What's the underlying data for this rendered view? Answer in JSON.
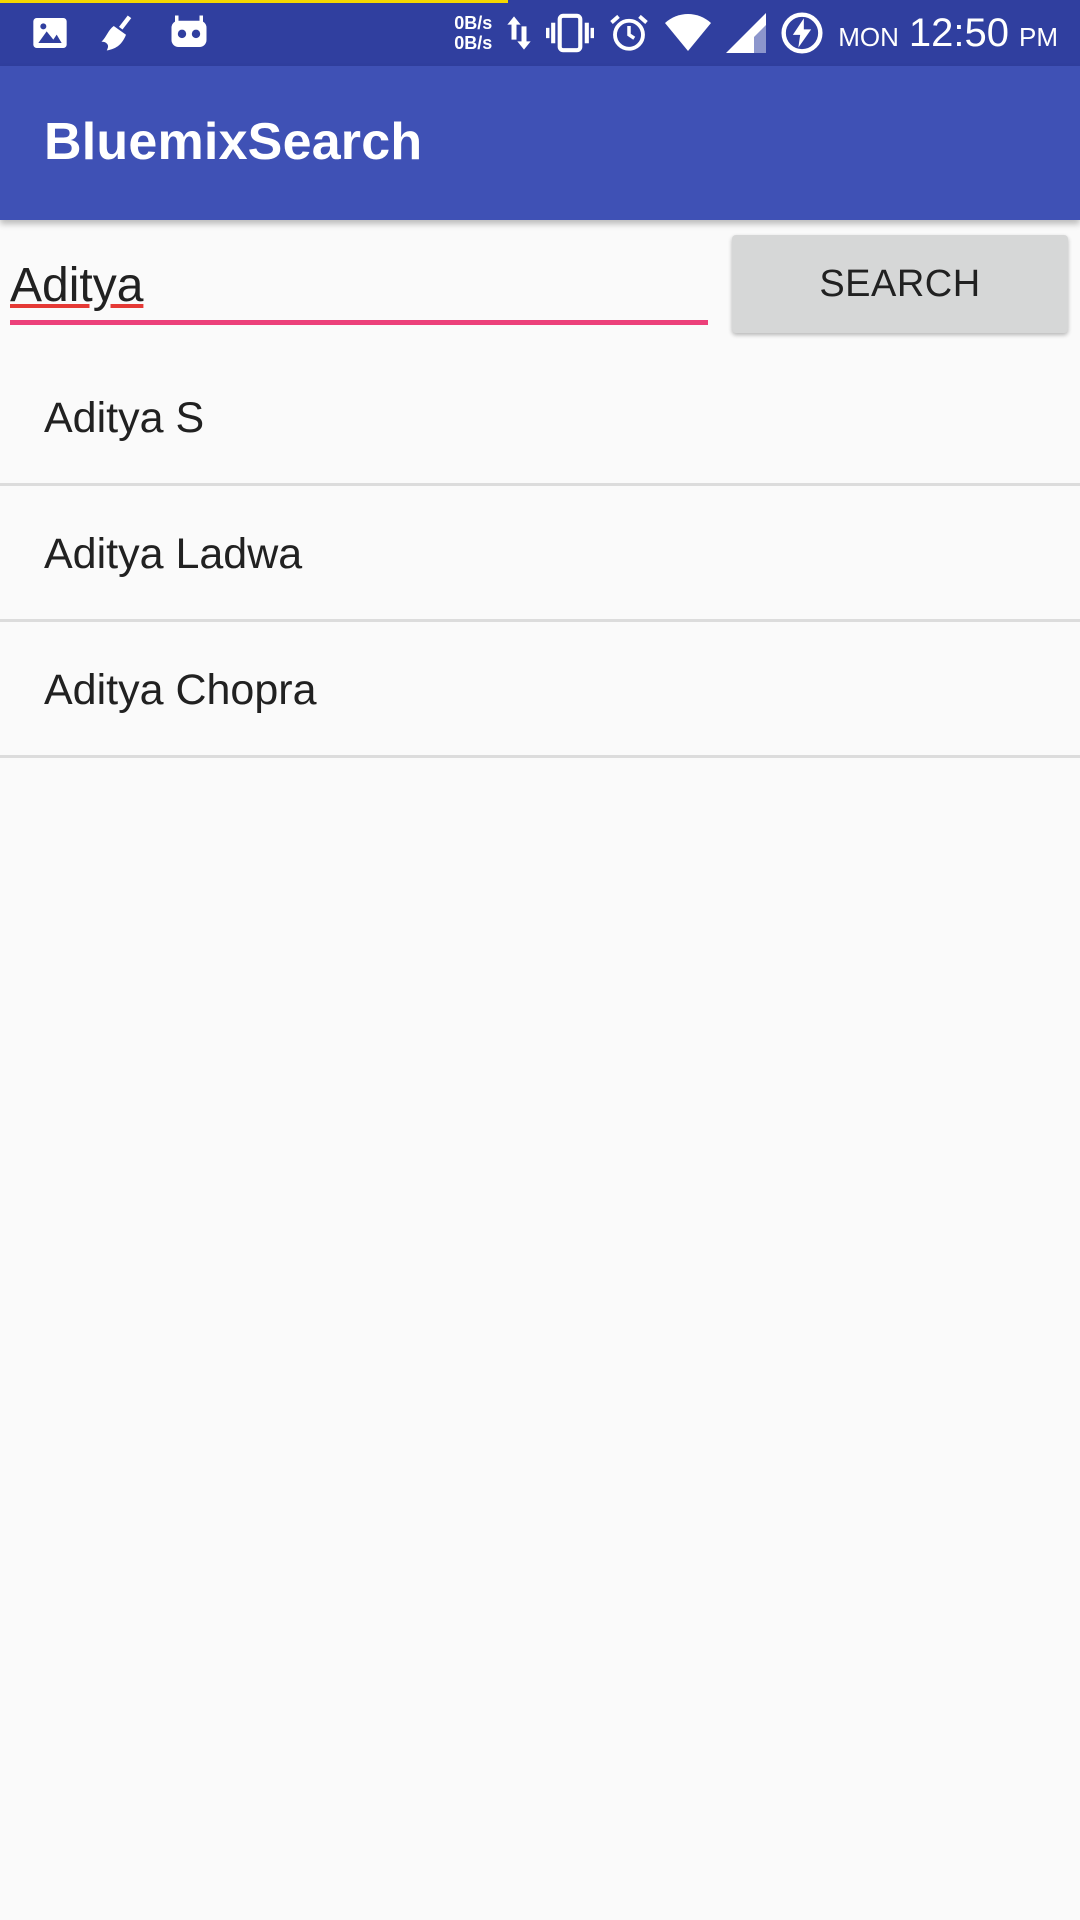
{
  "status_bar": {
    "net_speed_up": "0B/s",
    "net_speed_down": "0B/s",
    "day": "MON",
    "time": "12:50",
    "ampm": "PM",
    "progress_fraction": 0.47,
    "icons_left": [
      "image-icon",
      "broom-icon",
      "android-face-icon"
    ],
    "icons_right": [
      "data-arrows-icon",
      "vibrate-icon",
      "alarm-icon",
      "wifi-icon",
      "signal-icon",
      "battery-charging-icon"
    ]
  },
  "app_bar": {
    "title": "BluemixSearch"
  },
  "search": {
    "query": "Aditya",
    "button_label": "SEARCH"
  },
  "results": [
    {
      "name": "Aditya S"
    },
    {
      "name": "Aditya Ladwa"
    },
    {
      "name": "Aditya Chopra"
    }
  ],
  "colors": {
    "status_bar": "#303f9f",
    "app_bar": "#3f51b5",
    "accent": "#ec407a",
    "progress": "#f5d800",
    "background": "#fafafa"
  }
}
